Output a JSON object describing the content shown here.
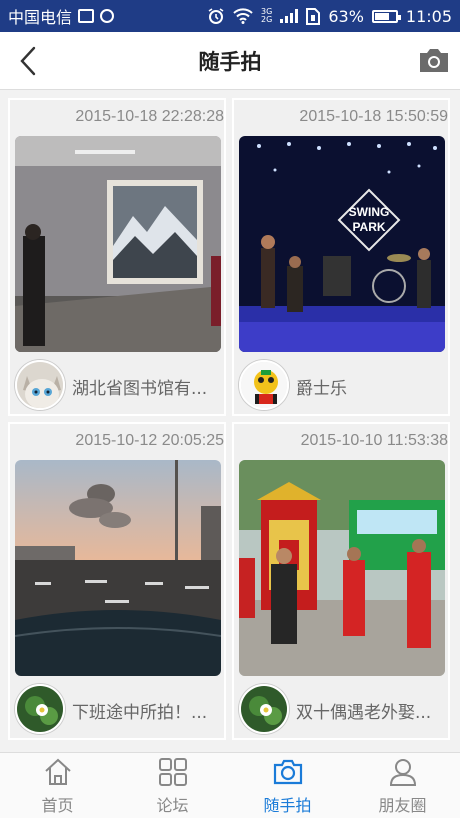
{
  "status_bar": {
    "carrier": "中国电信",
    "network_top": "3G",
    "network_bottom": "2G",
    "battery": "63%",
    "battery_level": 0.63,
    "time": "11:05"
  },
  "header": {
    "title": "随手拍"
  },
  "feed": [
    {
      "timestamp": "2015-10-18 22:28:28",
      "caption": "湖北省图书馆有..."
    },
    {
      "timestamp": "2015-10-18 15:50:59",
      "caption": "爵士乐",
      "photo_sign_line1": "SWING",
      "photo_sign_line2": "PARK"
    },
    {
      "timestamp": "2015-10-12 20:05:25",
      "caption": "下班途中所拍！..."
    },
    {
      "timestamp": "2015-10-10 11:53:38",
      "caption": "双十偶遇老外娶..."
    }
  ],
  "tabbar": {
    "items": [
      {
        "label": "首页",
        "icon": "home-icon"
      },
      {
        "label": "论坛",
        "icon": "grid-icon"
      },
      {
        "label": "随手拍",
        "icon": "camera-icon"
      },
      {
        "label": "朋友圈",
        "icon": "person-icon"
      }
    ],
    "active_index": 2
  },
  "colors": {
    "status_bar": "#1f3c86",
    "accent": "#1a7bd8",
    "muted_text": "#8a8a8a"
  }
}
